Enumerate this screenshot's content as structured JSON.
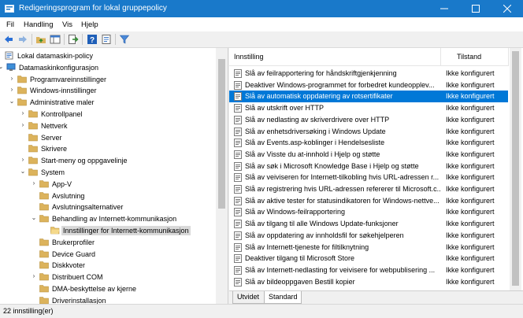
{
  "window": {
    "title": "Redigeringsprogram for lokal gruppepolicy",
    "titlebar_color": "#1979ca",
    "buttons": [
      "minimize-icon",
      "maximize-icon",
      "close-icon"
    ]
  },
  "menu": {
    "items": [
      "Fil",
      "Handling",
      "Vis",
      "Hjelp"
    ]
  },
  "toolbar": {
    "buttons": [
      "back-arrow-icon",
      "forward-arrow-icon",
      "up-folder-icon",
      "show-hide-tree-icon",
      "export-list-icon",
      "help-icon",
      "properties-icon",
      "filter-icon"
    ]
  },
  "tree": {
    "items": [
      {
        "label": "Lokal datamaskin-policy",
        "level": 0,
        "expander": "",
        "icon": "computer-policy-icon"
      },
      {
        "label": "Datamaskinkonfigurasjon",
        "level": 1,
        "expander": "open",
        "icon": "computer-icon"
      },
      {
        "label": "Programvareinnstillinger",
        "level": 2,
        "expander": "closed",
        "icon": "folder-icon"
      },
      {
        "label": "Windows-innstillinger",
        "level": 2,
        "expander": "closed",
        "icon": "folder-icon"
      },
      {
        "label": "Administrative maler",
        "level": 2,
        "expander": "open",
        "icon": "folder-icon"
      },
      {
        "label": "Kontrollpanel",
        "level": 3,
        "expander": "closed",
        "icon": "folder-icon"
      },
      {
        "label": "Nettverk",
        "level": 3,
        "expander": "closed",
        "icon": "folder-icon"
      },
      {
        "label": "Server",
        "level": 3,
        "expander": "",
        "icon": "folder-icon"
      },
      {
        "label": "Skrivere",
        "level": 3,
        "expander": "",
        "icon": "folder-icon"
      },
      {
        "label": "Start-meny og oppgavelinje",
        "level": 3,
        "expander": "closed",
        "icon": "folder-icon"
      },
      {
        "label": "System",
        "level": 3,
        "expander": "open",
        "icon": "folder-icon"
      },
      {
        "label": "App-V",
        "level": 4,
        "expander": "closed",
        "icon": "folder-icon"
      },
      {
        "label": "Avslutning",
        "level": 4,
        "expander": "",
        "icon": "folder-icon"
      },
      {
        "label": "Avslutningsalternativer",
        "level": 4,
        "expander": "",
        "icon": "folder-icon"
      },
      {
        "label": "Behandling av Internett-kommunikasjon",
        "level": 4,
        "expander": "open",
        "icon": "folder-icon"
      },
      {
        "label": "Innstillinger for Internett-kommunikasjon",
        "level": 5,
        "expander": "",
        "icon": "open-folder-icon",
        "selected": true
      },
      {
        "label": "Brukerprofiler",
        "level": 4,
        "expander": "",
        "icon": "folder-icon"
      },
      {
        "label": "Device Guard",
        "level": 4,
        "expander": "",
        "icon": "folder-icon"
      },
      {
        "label": "Diskkvoter",
        "level": 4,
        "expander": "",
        "icon": "folder-icon"
      },
      {
        "label": "Distribuert COM",
        "level": 4,
        "expander": "closed",
        "icon": "folder-icon"
      },
      {
        "label": "DMA-beskyttelse av kjerne",
        "level": 4,
        "expander": "",
        "icon": "folder-icon"
      },
      {
        "label": "Driverinstallasjon",
        "level": 4,
        "expander": "",
        "icon": "folder-icon"
      }
    ]
  },
  "list": {
    "headers": {
      "name": "Innstilling",
      "state": "Tilstand"
    },
    "rows": [
      {
        "name": "Slå av feilrapportering for håndskriftgjenkjenning",
        "state": "Ikke konfigurert"
      },
      {
        "name": "Deaktiver Windows-programmet for forbedret kundeopplev...",
        "state": "Ikke konfigurert"
      },
      {
        "name": "Slå av automatisk oppdatering av rotsertifikater",
        "state": "Ikke konfigurert",
        "selected": true
      },
      {
        "name": "Slå av utskrift over HTTP",
        "state": "Ikke konfigurert"
      },
      {
        "name": "Slå av nedlasting av skriverdrivere over HTTP",
        "state": "Ikke konfigurert"
      },
      {
        "name": "Slå av enhetsdriversøking i Windows Update",
        "state": "Ikke konfigurert"
      },
      {
        "name": "Slå av Events.asp-koblinger i Hendelsesliste",
        "state": "Ikke konfigurert"
      },
      {
        "name": "Slå av Visste du at-innhold i Hjelp og støtte",
        "state": "Ikke konfigurert"
      },
      {
        "name": "Slå av søk i Microsoft Knowledge Base i Hjelp og støtte",
        "state": "Ikke konfigurert"
      },
      {
        "name": "Slå av veiviseren for Internett-tilkobling hvis URL-adressen r...",
        "state": "Ikke konfigurert"
      },
      {
        "name": "Slå av registrering hvis URL-adressen refererer til Microsoft.c...",
        "state": "Ikke konfigurert"
      },
      {
        "name": "Slå av aktive tester for statusindikatoren for Windows-nettve...",
        "state": "Ikke konfigurert"
      },
      {
        "name": "Slå av Windows-feilrapportering",
        "state": "Ikke konfigurert"
      },
      {
        "name": "Slå av tilgang til alle Windows Update-funksjoner",
        "state": "Ikke konfigurert"
      },
      {
        "name": "Slå av oppdatering av innholdsfil for søkehjelperen",
        "state": "Ikke konfigurert"
      },
      {
        "name": "Slå av Internett-tjeneste for filtilknytning",
        "state": "Ikke konfigurert"
      },
      {
        "name": "Deaktiver tilgang til Microsoft Store",
        "state": "Ikke konfigurert"
      },
      {
        "name": "Slå av Internett-nedlasting for veivisere for webpublisering ...",
        "state": "Ikke konfigurert"
      },
      {
        "name": "Slå av bildeoppgaven Bestill kopier",
        "state": "Ikke konfigurert"
      }
    ]
  },
  "tabs": [
    {
      "label": "Utvidet",
      "active": false
    },
    {
      "label": "Standard",
      "active": true
    }
  ],
  "status": {
    "text": "22 innstilling(er)"
  },
  "colors": {
    "selection": "#0078d7",
    "folder": "#dcb35c",
    "tree_selection": "#d9d9d9"
  }
}
